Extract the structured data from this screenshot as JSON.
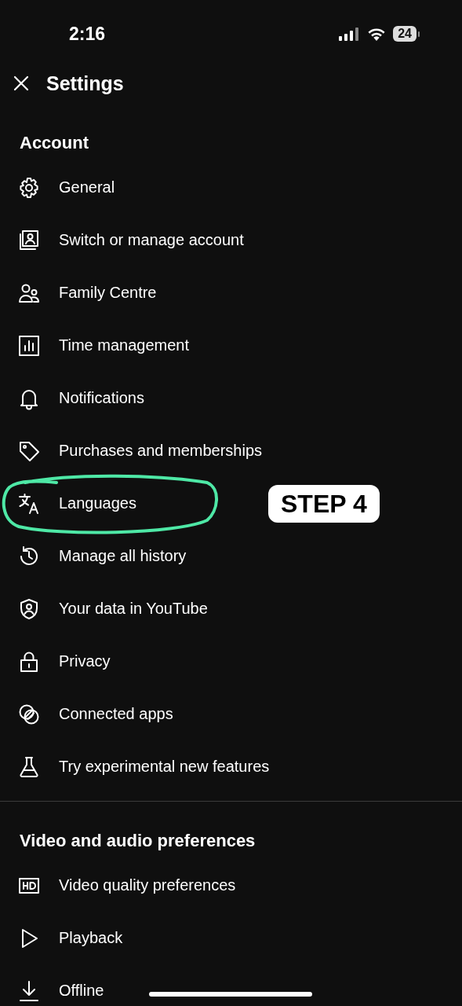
{
  "status_bar": {
    "time": "2:16",
    "battery": "24"
  },
  "header": {
    "title": "Settings"
  },
  "sections": [
    {
      "title": "Account",
      "items": [
        {
          "label": "General",
          "circled": false
        },
        {
          "label": "Switch or manage account",
          "circled": false
        },
        {
          "label": "Family Centre",
          "circled": false
        },
        {
          "label": "Time management",
          "circled": false
        },
        {
          "label": "Notifications",
          "circled": false
        },
        {
          "label": "Purchases and memberships",
          "circled": false
        },
        {
          "label": "Languages",
          "circled": true
        },
        {
          "label": "Manage all history",
          "circled": false
        },
        {
          "label": "Your data in YouTube",
          "circled": false
        },
        {
          "label": "Privacy",
          "circled": false
        },
        {
          "label": "Connected apps",
          "circled": false
        },
        {
          "label": "Try experimental new features",
          "circled": false
        }
      ]
    },
    {
      "title": "Video and audio preferences",
      "items": [
        {
          "label": "Video quality preferences",
          "circled": false
        },
        {
          "label": "Playback",
          "circled": false
        },
        {
          "label": "Offline",
          "circled": false
        }
      ]
    }
  ],
  "annotation": {
    "label": "STEP 4"
  }
}
